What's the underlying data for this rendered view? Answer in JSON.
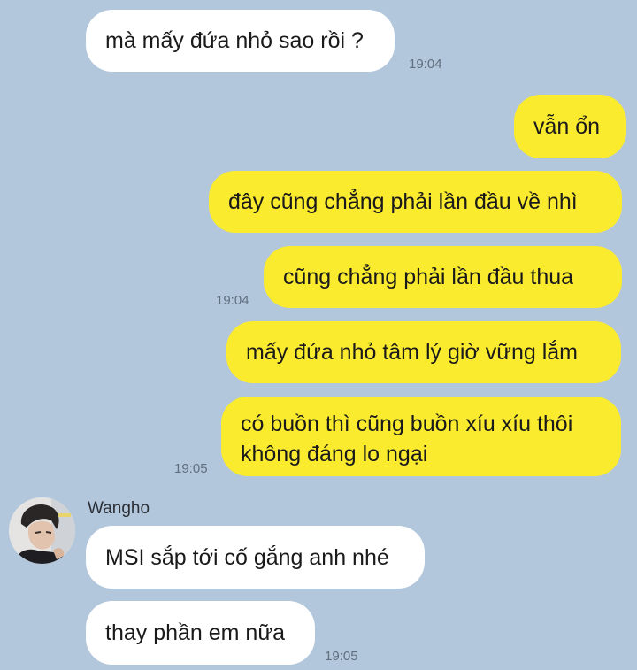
{
  "messages": [
    {
      "text": "mà mấy đứa nhỏ sao rồi ?",
      "time": "19:04"
    },
    {
      "text": "vẫn ổn"
    },
    {
      "text": "đây cũng chẳng phải lần đầu về nhì"
    },
    {
      "text": "cũng chẳng phải lần đầu thua",
      "time": "19:04"
    },
    {
      "text": "mấy đứa nhỏ tâm lý giờ vững lắm"
    },
    {
      "line1": "có buồn thì cũng buồn xíu xíu thôi",
      "line2": "không đáng lo ngại",
      "time": "19:05"
    },
    {
      "sender": "Wangho",
      "text": "MSI sắp tới cố gắng anh nhé"
    },
    {
      "text": "thay phần em nữa",
      "time": "19:05"
    }
  ],
  "colors": {
    "background": "#b3c7dc",
    "incoming_bubble": "#ffffff",
    "outgoing_bubble": "#fbeb2f",
    "timestamp": "#5f6f7f"
  },
  "icons": {
    "avatar": "avatar-icon"
  }
}
